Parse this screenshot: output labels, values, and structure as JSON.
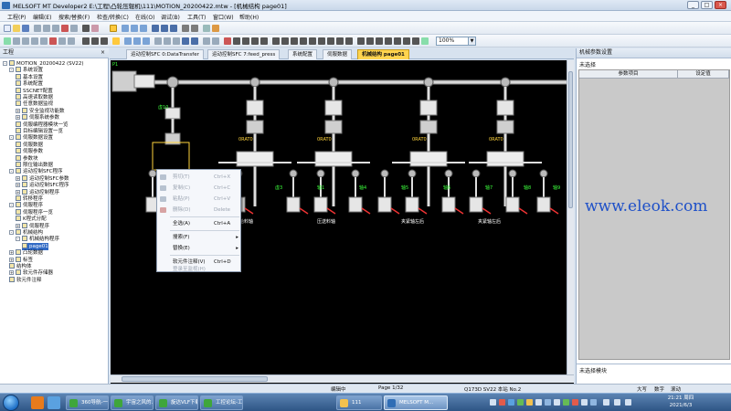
{
  "window": {
    "title": "MELSOFT MT Developer2 E:\\工程\\凸轮压辊机\\111\\MOTION_20200422.mtw - [机械结构 page01]",
    "min_label": "_",
    "max_label": "□",
    "close_label": "×"
  },
  "menu": [
    "工程(P)",
    "编辑(E)",
    "搜索/替换(F)",
    "检查/转换(C)",
    "在线(O)",
    "调试(B)",
    "工具(T)",
    "窗口(W)",
    "帮助(H)"
  ],
  "toolbar": {
    "zoom_value": "100%"
  },
  "project_panel": {
    "title": "工程",
    "tree": [
      {
        "label": "MOTION_20200422 (SV22)",
        "level": 0,
        "exp": "-"
      },
      {
        "label": "系统设置",
        "level": 1,
        "exp": "-"
      },
      {
        "label": "基本设置",
        "level": 2
      },
      {
        "label": "系统配置",
        "level": 2
      },
      {
        "label": "SSCNET配置",
        "level": 2
      },
      {
        "label": "高速读取数据",
        "level": 2
      },
      {
        "label": "任意数据监视",
        "level": 2
      },
      {
        "label": "安全监视功能数",
        "level": 2,
        "exp": "+"
      },
      {
        "label": "伺服系统参数",
        "level": 2,
        "exp": "+"
      },
      {
        "label": "伺服编程器模块一览",
        "level": 2
      },
      {
        "label": "目标编辑设置一览",
        "level": 2
      },
      {
        "label": "伺服数据设置",
        "level": 1,
        "exp": "-"
      },
      {
        "label": "伺服数据",
        "level": 2
      },
      {
        "label": "伺服参数",
        "level": 2
      },
      {
        "label": "参数块",
        "level": 2
      },
      {
        "label": "限位输出数据",
        "level": 2
      },
      {
        "label": "运动控制SFC程序",
        "level": 1,
        "exp": "-"
      },
      {
        "label": "运动控制SFC参数",
        "level": 2,
        "exp": "+"
      },
      {
        "label": "运动控制SFC程序",
        "level": 2,
        "exp": "+"
      },
      {
        "label": "运动控制程序",
        "level": 2,
        "exp": "+"
      },
      {
        "label": "转移程序",
        "level": 2
      },
      {
        "label": "伺服程序",
        "level": 1,
        "exp": "-"
      },
      {
        "label": "伺服程序一览",
        "level": 2
      },
      {
        "label": "K程式分配",
        "level": 2
      },
      {
        "label": "伺服程序",
        "level": 2,
        "exp": "+"
      },
      {
        "label": "机械结构",
        "level": 1,
        "exp": "-"
      },
      {
        "label": "机械结构程序",
        "level": 2,
        "exp": "-"
      },
      {
        "label": "page01",
        "level": 3,
        "selected": true
      },
      {
        "label": "凸轮数据",
        "level": 1,
        "exp": "+"
      },
      {
        "label": "标签",
        "level": 1,
        "exp": "+"
      },
      {
        "label": "结构体",
        "level": 1
      },
      {
        "label": "软元件存储器",
        "level": 1,
        "exp": "+"
      },
      {
        "label": "软元件注释",
        "level": 1
      }
    ]
  },
  "tabs": [
    {
      "label": "运动控制SFC 0:DataTransfer",
      "active": false
    },
    {
      "label": "运动控制SFC 7:feed_press",
      "active": false
    },
    {
      "label": "系统配置",
      "active": false
    },
    {
      "label": "伺服数据",
      "active": false
    },
    {
      "label": "机械结构 page01",
      "active": true
    }
  ],
  "canvas": {
    "corner_label": "P1",
    "labels_green": [
      "虚10",
      "虚3",
      "轴1",
      "轴4",
      "轴5",
      "轴6",
      "轴7",
      "轴8",
      "轴9"
    ],
    "labels_yellow": [
      "0RAT0",
      "0RAT0",
      "0RAT0",
      "0RAT0"
    ],
    "labels_white": [
      "进给料轴",
      "压送料轴",
      "夹紧轴左后",
      "夹紧轴左后"
    ]
  },
  "context_menu": {
    "items": [
      {
        "label": "剪切(T)",
        "shortcut": "Ctrl+X",
        "enabled": false,
        "icon": "cut-icon"
      },
      {
        "label": "复制(C)",
        "shortcut": "Ctrl+C",
        "enabled": false,
        "icon": "copy-icon"
      },
      {
        "label": "粘贴(P)",
        "shortcut": "Ctrl+V",
        "enabled": false,
        "icon": "paste-icon"
      },
      {
        "label": "删除(D)",
        "shortcut": "Delete",
        "enabled": false,
        "icon": "delete-icon"
      },
      {
        "label": "全选(A)",
        "shortcut": "Ctrl+A",
        "enabled": true
      },
      {
        "label": "搜索(F)",
        "shortcut": "",
        "enabled": true,
        "submenu": true
      },
      {
        "label": "替换(E)",
        "shortcut": "",
        "enabled": true,
        "submenu": true
      },
      {
        "label": "软元件注释(V)",
        "shortcut": "Ctrl+D",
        "enabled": true
      },
      {
        "label": "登录至监视(H)",
        "shortcut": "",
        "enabled": false
      }
    ]
  },
  "param_panel": {
    "title": "机械参数设置",
    "selection": "未选择",
    "col1": "参数项目",
    "col2": "设定值",
    "bottom_label": "未选择模块"
  },
  "statusbar": {
    "mode": "编辑中",
    "page": "Page  1/32",
    "cpu": "Q173D   SV22   本站 No.2",
    "caps": "大写",
    "num": "数字",
    "ovr": "滚动"
  },
  "taskbar": {
    "buttons": [
      {
        "label": "360导航-一个...",
        "active": false,
        "color": "#3fa63b"
      },
      {
        "label": "宇宙之风的...",
        "active": false,
        "color": "#3fa63b"
      },
      {
        "label": "旋达VLF下载...",
        "active": false,
        "color": "#3fa63b"
      },
      {
        "label": "工控论坛-工控...",
        "active": false,
        "color": "#3fa63b"
      },
      {
        "label": "111",
        "active": false,
        "color": "#f2c14e"
      },
      {
        "label": "MELSOFT M...",
        "active": true,
        "color": "#2f6db5"
      }
    ],
    "time": "21:21 周四",
    "date": "2021/6/3"
  },
  "watermark": "www.eleok.com"
}
